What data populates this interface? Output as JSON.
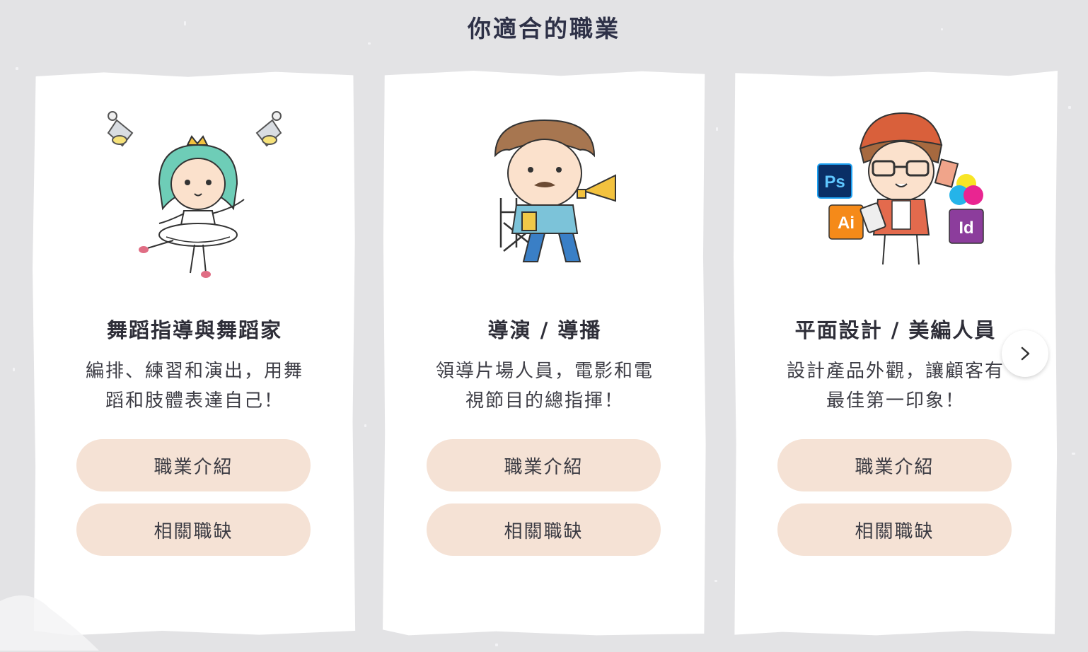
{
  "page": {
    "title": "你適合的職業"
  },
  "cards": [
    {
      "title": "舞蹈指導與舞蹈家",
      "description": [
        "編排、練習和演出，用舞",
        "蹈和肢體表達自己！"
      ],
      "illustration_icon": "dancer-illustration",
      "buttons": {
        "intro": "職業介紹",
        "jobs": "相關職缺"
      }
    },
    {
      "title": "導演 / 導播",
      "description": [
        "領導片場人員，電影和電",
        "視節目的總指揮！"
      ],
      "illustration_icon": "director-illustration",
      "buttons": {
        "intro": "職業介紹",
        "jobs": "相關職缺"
      }
    },
    {
      "title": "平面設計 / 美編人員",
      "description": [
        "設計產品外觀，讓顧客有",
        "最佳第一印象！"
      ],
      "illustration_icon": "designer-illustration",
      "illustration_labels": {
        "ps": "Ps",
        "ai": "Ai",
        "id": "Id"
      },
      "buttons": {
        "intro": "職業介紹",
        "jobs": "相關職缺"
      }
    }
  ],
  "carousel": {
    "next_icon": "chevron-right-icon"
  },
  "colors": {
    "background": "#e3e3e5",
    "card": "#ffffff",
    "button": "#f5e2d5",
    "title": "#2e3147"
  }
}
